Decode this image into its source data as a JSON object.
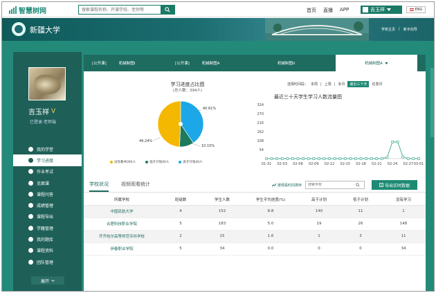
{
  "header": {
    "logo_text": "智慧树网",
    "search_placeholder": "搜索课程名称、开课学校、老师等",
    "nav": [
      "首页",
      "直播",
      "APP"
    ],
    "user_name": "吉玉祥",
    "lang": "ENG"
  },
  "banner": {
    "university": "新疆大学",
    "links": [
      "学校主页",
      "新手向导"
    ]
  },
  "profile": {
    "name": "吉玉祥",
    "badge": "V",
    "role": "已登录·老师端",
    "menu": [
      {
        "label": "我的学堂",
        "active": false
      },
      {
        "label": "学习进度",
        "active": true
      },
      {
        "label": "作业考试",
        "active": false
      },
      {
        "label": "见面课",
        "active": false
      },
      {
        "label": "课程问答",
        "active": false
      },
      {
        "label": "成绩管理",
        "active": false
      },
      {
        "label": "课程导出",
        "active": false
      },
      {
        "label": "学籍管理",
        "active": false
      },
      {
        "label": "我的题库",
        "active": false
      },
      {
        "label": "课程资料",
        "active": false
      },
      {
        "label": "团队管理",
        "active": false
      }
    ],
    "expand_label": "展开"
  },
  "course_tabs": [
    {
      "tag": "[公开课]",
      "name": "机械制图I"
    },
    {
      "tag": "[公开课]",
      "name": "机械制图A"
    },
    {
      "tag": "",
      "name": "机械制图II"
    },
    {
      "tag": "",
      "name": "机械制图A"
    }
  ],
  "donut": {
    "title": "学习进度占比图",
    "subtitle": "(总人数：394人)",
    "labels": [
      "40.61%",
      "10.15%",
      "49.24%"
    ],
    "legend": [
      "没有看书394人",
      "低于计划40人",
      "高于计划40人"
    ]
  },
  "time_select": {
    "label": "选择时间段：",
    "options": [
      "本周",
      "上周",
      "本月",
      "最近三十天",
      "任意月"
    ],
    "active": "最近三十天"
  },
  "line_chart_title": "最近三十天学生学习人数流量图",
  "status_tabs": [
    "学校状况",
    "视频观看统计"
  ],
  "follow_label": "按观看时间排序",
  "school_search_placeholder": "搜索学校",
  "export_label": "导出实时数据",
  "table": {
    "headers": [
      "所属学校",
      "班级数",
      "学生人数",
      "学生平均进度(%)",
      "高于计划",
      "低于计划",
      "没有学习"
    ],
    "rows": [
      [
        "中国民航大学",
        "4",
        "152",
        "8.8",
        "140",
        "11",
        "1"
      ],
      [
        "合肥科技职业学院",
        "5",
        "183",
        "5.0",
        "19",
        "26",
        "148"
      ],
      [
        "齐齐哈尔高等师范专科学校",
        "2",
        "15",
        "1.6",
        "1",
        "3",
        "11"
      ],
      [
        "伊春职业学院",
        "5",
        "34",
        "0.0",
        "0",
        "0",
        "34"
      ]
    ]
  },
  "chart_data": [
    {
      "type": "pie",
      "title": "学习进度占比图",
      "subtitle": "(总人数：394人)",
      "categories": [
        "没有看书",
        "低于计划",
        "高于计划"
      ],
      "values": [
        49.24,
        10.15,
        40.61
      ],
      "colors": [
        "#f5b800",
        "#1e7a5c",
        "#1ca8e8"
      ]
    },
    {
      "type": "line",
      "title": "最近三十天学生学习人数流量图",
      "x": [
        "01-31",
        "02-01",
        "02-02",
        "02-03",
        "02-04",
        "02-05",
        "02-06",
        "02-07",
        "02-08",
        "02-09",
        "02-10",
        "02-11",
        "02-12",
        "02-13",
        "02-14",
        "02-15",
        "02-16",
        "02-17",
        "02-18",
        "02-19",
        "02-20",
        "02-21",
        "02-22",
        "02-23",
        "02-24",
        "02-25",
        "02-26",
        "02-27",
        "02-28",
        "03-01"
      ],
      "x_ticks": [
        "01-31",
        "02-03",
        "02-06",
        "02-09",
        "02-12",
        "02-15",
        "02-18",
        "02-21",
        "02-24",
        "02-27",
        "03-01"
      ],
      "y": [
        0,
        0,
        0,
        0,
        0,
        0,
        0,
        0,
        0,
        0,
        0,
        0,
        0,
        0,
        0,
        0,
        0,
        0,
        0,
        0,
        0,
        0,
        0,
        8,
        100,
        100,
        10,
        0,
        0,
        0
      ],
      "ylim": [
        0,
        324
      ],
      "yticks": [
        0,
        54,
        108,
        162,
        216,
        270,
        324
      ],
      "color": "#1e9a7c"
    }
  ]
}
